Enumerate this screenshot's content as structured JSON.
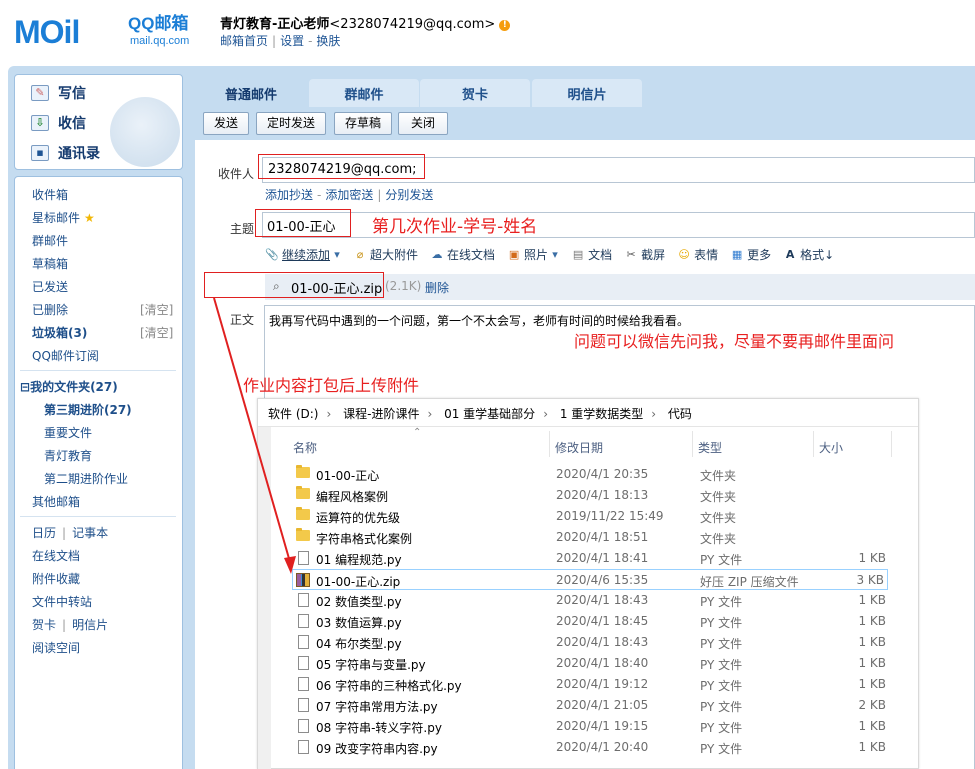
{
  "header": {
    "logo_text": "MOil",
    "brand": "QQ邮箱",
    "brand_sub": "mail.qq.com",
    "account_name": "青灯教育-正心老师",
    "account_email": "<2328074219@qq.com>",
    "links": [
      "邮箱首页",
      "设置",
      "换肤"
    ]
  },
  "sidebar": {
    "quick": [
      {
        "label": "写信",
        "icon": "pencil-icon"
      },
      {
        "label": "收信",
        "icon": "inbox-download-icon"
      },
      {
        "label": "通讯录",
        "icon": "contacts-card-icon"
      }
    ],
    "items": [
      {
        "label": "收件箱"
      },
      {
        "label": "星标邮件",
        "star": "★"
      },
      {
        "label": "群邮件"
      },
      {
        "label": "草稿箱"
      },
      {
        "label": "已发送"
      },
      {
        "label": "已删除",
        "clear": "[清空]"
      },
      {
        "label": "垃圾箱(3)",
        "clear": "[清空]",
        "bold": true
      },
      {
        "label": "QQ邮件订阅"
      }
    ],
    "folders_title": "我的文件夹(27)",
    "folders_toggle": "⊟",
    "folders": [
      "第三期进阶(27)",
      "重要文件",
      "青灯教育",
      "第二期进阶作业"
    ],
    "other_mail": "其他邮箱",
    "tools": [
      [
        "日历",
        "记事本"
      ],
      [
        "在线文档"
      ],
      [
        "附件收藏"
      ],
      [
        "文件中转站"
      ],
      [
        "贺卡",
        "明信片"
      ],
      [
        "阅读空间"
      ]
    ]
  },
  "tabs": [
    "普通邮件",
    "群邮件",
    "贺卡",
    "明信片"
  ],
  "toolbar": {
    "send": "发送",
    "timed_send": "定时发送",
    "save_draft": "存草稿",
    "close": "关闭"
  },
  "compose": {
    "to_label": "收件人",
    "to_value": "2328074219@qq.com;",
    "cc_links": [
      "添加抄送",
      "添加密送",
      "分别发送"
    ],
    "subject_label": "主题",
    "subject_value": "01-00-正心",
    "subject_note": "第几次作业-学号-姓名",
    "attach_tools": [
      "继续添加",
      "超大附件",
      "在线文档",
      "照片",
      "文档",
      "截屏",
      "表情",
      "更多",
      "格式↓"
    ],
    "attachment_name": "01-00-正心.zip",
    "attachment_size": "(2.1K)",
    "attachment_delete": "删除",
    "body_label": "正文",
    "body_text": "我再写代码中遇到的一个问题，第一个不太会写，老师有时间的时候给我看看。",
    "note_question": "问题可以微信先问我，尽量不要再邮件里面问",
    "note_upload": "作业内容打包后上传附件"
  },
  "explorer": {
    "breadcrumb": [
      "软件 (D:)",
      "课程-进阶课件",
      "01 重学基础部分",
      "1 重学数据类型",
      "代码"
    ],
    "columns": [
      "名称",
      "修改日期",
      "类型",
      "大小"
    ],
    "files": [
      {
        "name": "01-00-正心",
        "date": "2020/4/1 20:35",
        "type": "文件夹",
        "size": "",
        "kind": "folder"
      },
      {
        "name": "编程风格案例",
        "date": "2020/4/1 18:13",
        "type": "文件夹",
        "size": "",
        "kind": "folder"
      },
      {
        "name": "运算符的优先级",
        "date": "2019/11/22 15:49",
        "type": "文件夹",
        "size": "",
        "kind": "folder"
      },
      {
        "name": "字符串格式化案例",
        "date": "2020/4/1 18:51",
        "type": "文件夹",
        "size": "",
        "kind": "folder"
      },
      {
        "name": "01 编程规范.py",
        "date": "2020/4/1 18:41",
        "type": "PY 文件",
        "size": "1 KB",
        "kind": "doc"
      },
      {
        "name": "01-00-正心.zip",
        "date": "2020/4/6 15:35",
        "type": "好压 ZIP 压缩文件",
        "size": "3 KB",
        "kind": "zip"
      },
      {
        "name": "02 数值类型.py",
        "date": "2020/4/1 18:43",
        "type": "PY 文件",
        "size": "1 KB",
        "kind": "doc"
      },
      {
        "name": "03 数值运算.py",
        "date": "2020/4/1 18:45",
        "type": "PY 文件",
        "size": "1 KB",
        "kind": "doc"
      },
      {
        "name": "04 布尔类型.py",
        "date": "2020/4/1 18:43",
        "type": "PY 文件",
        "size": "1 KB",
        "kind": "doc"
      },
      {
        "name": "05 字符串与变量.py",
        "date": "2020/4/1 18:40",
        "type": "PY 文件",
        "size": "1 KB",
        "kind": "doc"
      },
      {
        "name": "06 字符串的三种格式化.py",
        "date": "2020/4/1 19:12",
        "type": "PY 文件",
        "size": "1 KB",
        "kind": "doc"
      },
      {
        "name": "07 字符串常用方法.py",
        "date": "2020/4/1 21:05",
        "type": "PY 文件",
        "size": "2 KB",
        "kind": "doc"
      },
      {
        "name": "08 字符串-转义字符.py",
        "date": "2020/4/1 19:15",
        "type": "PY 文件",
        "size": "1 KB",
        "kind": "doc"
      },
      {
        "name": "09 改变字符串内容.py",
        "date": "2020/4/1 20:40",
        "type": "PY 文件",
        "size": "1 KB",
        "kind": "doc"
      }
    ]
  },
  "colors": {
    "brand_blue": "#1b7ed6",
    "frame_blue": "#c5dcf0",
    "annotation_red": "#e02020"
  }
}
